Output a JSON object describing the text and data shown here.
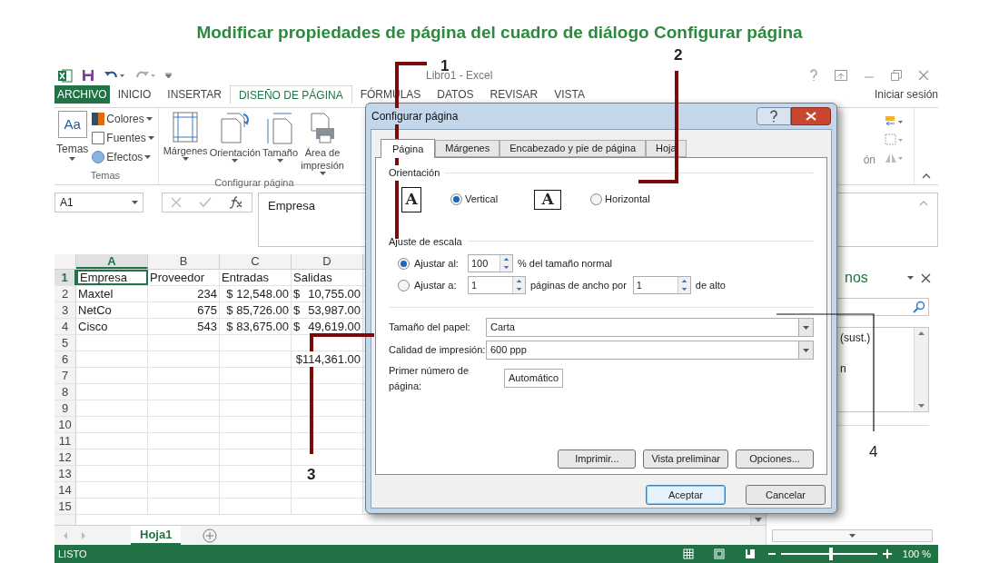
{
  "page_title": "Modificar propiedades de página del cuadro de diálogo Configurar página",
  "excel": {
    "window_title": "Libro1 - Excel",
    "sign_in": "Iniciar sesión",
    "ribbon_tabs": [
      {
        "label": "ARCHIVO",
        "kind": "file",
        "selected": false
      },
      {
        "label": "INICIO",
        "kind": "tab",
        "selected": false
      },
      {
        "label": "INSERTAR",
        "kind": "tab",
        "selected": false
      },
      {
        "label": "DISEÑO DE PÁGINA",
        "kind": "tab",
        "selected": true
      },
      {
        "label": "FÓRMULAS",
        "kind": "tab",
        "selected": false
      },
      {
        "label": "DATOS",
        "kind": "tab",
        "selected": false
      },
      {
        "label": "REVISAR",
        "kind": "tab",
        "selected": false
      },
      {
        "label": "VISTA",
        "kind": "tab",
        "selected": false
      }
    ],
    "themes_group": {
      "label": "Temas",
      "big_button": "Temas",
      "big_glyph": "Aa",
      "small_buttons": [
        "Colores",
        "Fuentes",
        "Efectos"
      ]
    },
    "page_setup_group": {
      "label": "Configurar página",
      "buttons": [
        {
          "label": "Márgenes",
          "kind": "margins"
        },
        {
          "label": "Orientación",
          "kind": "orientation"
        },
        {
          "label": "Tamaño",
          "kind": "size"
        },
        {
          "label": "Área de impresión",
          "kind": "print_area"
        }
      ]
    },
    "ribbon_fragment": "ón",
    "name_box": "A1",
    "formula": "Empresa",
    "columns": [
      {
        "label": "A",
        "selected": true
      },
      {
        "label": "B",
        "selected": false
      },
      {
        "label": "C",
        "selected": false
      },
      {
        "label": "D",
        "selected": false
      }
    ],
    "rows": [
      {
        "n": "1",
        "selected": true,
        "cells": [
          {
            "kind": "text",
            "text": "Empresa"
          },
          {
            "kind": "text",
            "text": "Proveedor"
          },
          {
            "kind": "text",
            "text": "Entradas"
          },
          {
            "kind": "text",
            "text": "Salidas"
          }
        ]
      },
      {
        "n": "2",
        "selected": false,
        "cells": [
          {
            "kind": "text",
            "text": "Maxtel"
          },
          {
            "kind": "number",
            "text": "234"
          },
          {
            "kind": "number",
            "text": "$ 12,548.00"
          },
          {
            "kind": "accounting",
            "symbol": "$",
            "text": "10,755.00"
          }
        ]
      },
      {
        "n": "3",
        "selected": false,
        "cells": [
          {
            "kind": "text",
            "text": "NetCo"
          },
          {
            "kind": "number",
            "text": "675"
          },
          {
            "kind": "number",
            "text": "$ 85,726.00"
          },
          {
            "kind": "accounting",
            "symbol": "$",
            "text": "53,987.00"
          }
        ]
      },
      {
        "n": "4",
        "selected": false,
        "cells": [
          {
            "kind": "text",
            "text": "Cisco"
          },
          {
            "kind": "number",
            "text": "543"
          },
          {
            "kind": "number",
            "text": "$ 83,675.00"
          },
          {
            "kind": "accounting",
            "symbol": "$",
            "text": "49,619.00"
          }
        ]
      },
      {
        "n": "5",
        "selected": false,
        "cells": []
      },
      {
        "n": "6",
        "selected": false,
        "cells": [
          {
            "kind": "empty"
          },
          {
            "kind": "empty"
          },
          {
            "kind": "empty"
          },
          {
            "kind": "number",
            "text": "$114,361.00"
          }
        ]
      },
      {
        "n": "7",
        "selected": false,
        "cells": []
      },
      {
        "n": "8",
        "selected": false,
        "cells": []
      },
      {
        "n": "9",
        "selected": false,
        "cells": []
      },
      {
        "n": "10",
        "selected": false,
        "cells": []
      },
      {
        "n": "11",
        "selected": false,
        "cells": []
      },
      {
        "n": "12",
        "selected": false,
        "cells": []
      },
      {
        "n": "13",
        "selected": false,
        "cells": []
      },
      {
        "n": "14",
        "selected": false,
        "cells": []
      },
      {
        "n": "15",
        "selected": false,
        "cells": []
      }
    ],
    "sheet_tabs": [
      {
        "label": "Hoja1",
        "selected": true
      }
    ],
    "task_pane": {
      "title": "nos",
      "items": [
        "(sust.)",
        "n"
      ]
    },
    "status": "LISTO",
    "zoom": {
      "level": 0.5,
      "reading": "100 %"
    }
  },
  "dialog": {
    "title": "Configurar página",
    "tabs": [
      {
        "label": "Página",
        "selected": true
      },
      {
        "label": "Márgenes",
        "selected": false
      },
      {
        "label": "Encabezado y pie de página",
        "selected": false
      },
      {
        "label": "Hoja",
        "selected": false
      }
    ],
    "orientation": {
      "label": "Orientación",
      "options": [
        {
          "kind": "portrait",
          "glyph": "A",
          "label": "Vertical",
          "selected": true
        },
        {
          "kind": "landscape",
          "glyph": "A",
          "label": "Horizontal",
          "selected": false
        }
      ]
    },
    "scaling": {
      "label": "Ajuste de escala",
      "options": [
        {
          "kind": "percent",
          "label": "Ajustar al:",
          "selected": true,
          "value": "100",
          "suffix": "% del tamaño normal"
        },
        {
          "kind": "fit",
          "label": "Ajustar a:",
          "selected": false,
          "value": "1",
          "middle": "páginas de ancho por",
          "value2": "1",
          "suffix": "de alto"
        }
      ]
    },
    "fields": [
      {
        "kind": "dropdown",
        "label": "Tamaño del papel:",
        "value": "Carta"
      },
      {
        "kind": "dropdown",
        "label": "Calidad de impresión:",
        "value": "600 ppp"
      },
      {
        "kind": "text",
        "label": "Primer número de página:",
        "value": "Automático"
      }
    ],
    "action_buttons": [
      "Imprimir...",
      "Vista preliminar",
      "Opciones..."
    ],
    "footer_buttons": [
      {
        "label": "Aceptar",
        "default": true
      },
      {
        "label": "Cancelar",
        "default": false
      }
    ]
  },
  "callouts": [
    {
      "number": "1"
    },
    {
      "number": "2"
    },
    {
      "number": "3"
    },
    {
      "number": "4"
    }
  ]
}
